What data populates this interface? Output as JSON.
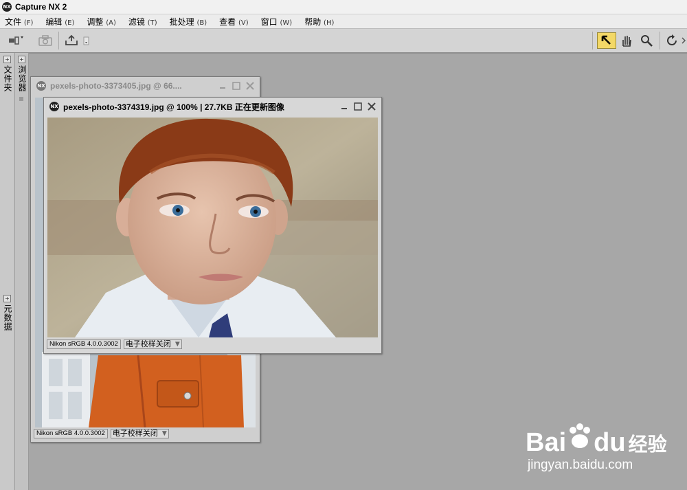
{
  "app": {
    "title": "Capture NX 2",
    "logo_text": "NX"
  },
  "menu": [
    {
      "label": "文件",
      "accel": "(F)"
    },
    {
      "label": "编辑",
      "accel": "(E)"
    },
    {
      "label": "调整",
      "accel": "(A)"
    },
    {
      "label": "滤镜",
      "accel": "(T)"
    },
    {
      "label": "批处理",
      "accel": "(B)"
    },
    {
      "label": "查看",
      "accel": "(V)"
    },
    {
      "label": "窗口",
      "accel": "(W)"
    },
    {
      "label": "帮助",
      "accel": "(H)"
    }
  ],
  "toolbar": {
    "left_tools": [
      "tool-options-icon",
      "camera-icon",
      "print-icon"
    ],
    "right_tools": [
      "direct-select-arrow-icon",
      "hand-icon",
      "zoom-icon",
      "rotate-icon"
    ]
  },
  "side_panels": {
    "folders": "文件夹",
    "browser": "浏览器",
    "metadata": "元数据",
    "expand_symbol": "+"
  },
  "back_window": {
    "title": "pexels-photo-3373405.jpg  @  66....",
    "profile": "Nikon sRGB 4.0.0.3002",
    "proof": "电子校样关闭"
  },
  "front_window": {
    "title": "pexels-photo-3374319.jpg  @  100%  |  27.7KB  正在更新图像",
    "profile": "Nikon sRGB 4.0.0.3002",
    "proof": "电子校样关闭"
  },
  "watermark": {
    "brand": "Bai",
    "brand2": "du",
    "cn": "经验",
    "url": "jingyan.baidu.com"
  },
  "colors": {
    "workspace": "#a7a7a7",
    "active_tool": "#f3d867",
    "jacket_orange": "#d2601f",
    "hair": "#8a3a17"
  }
}
